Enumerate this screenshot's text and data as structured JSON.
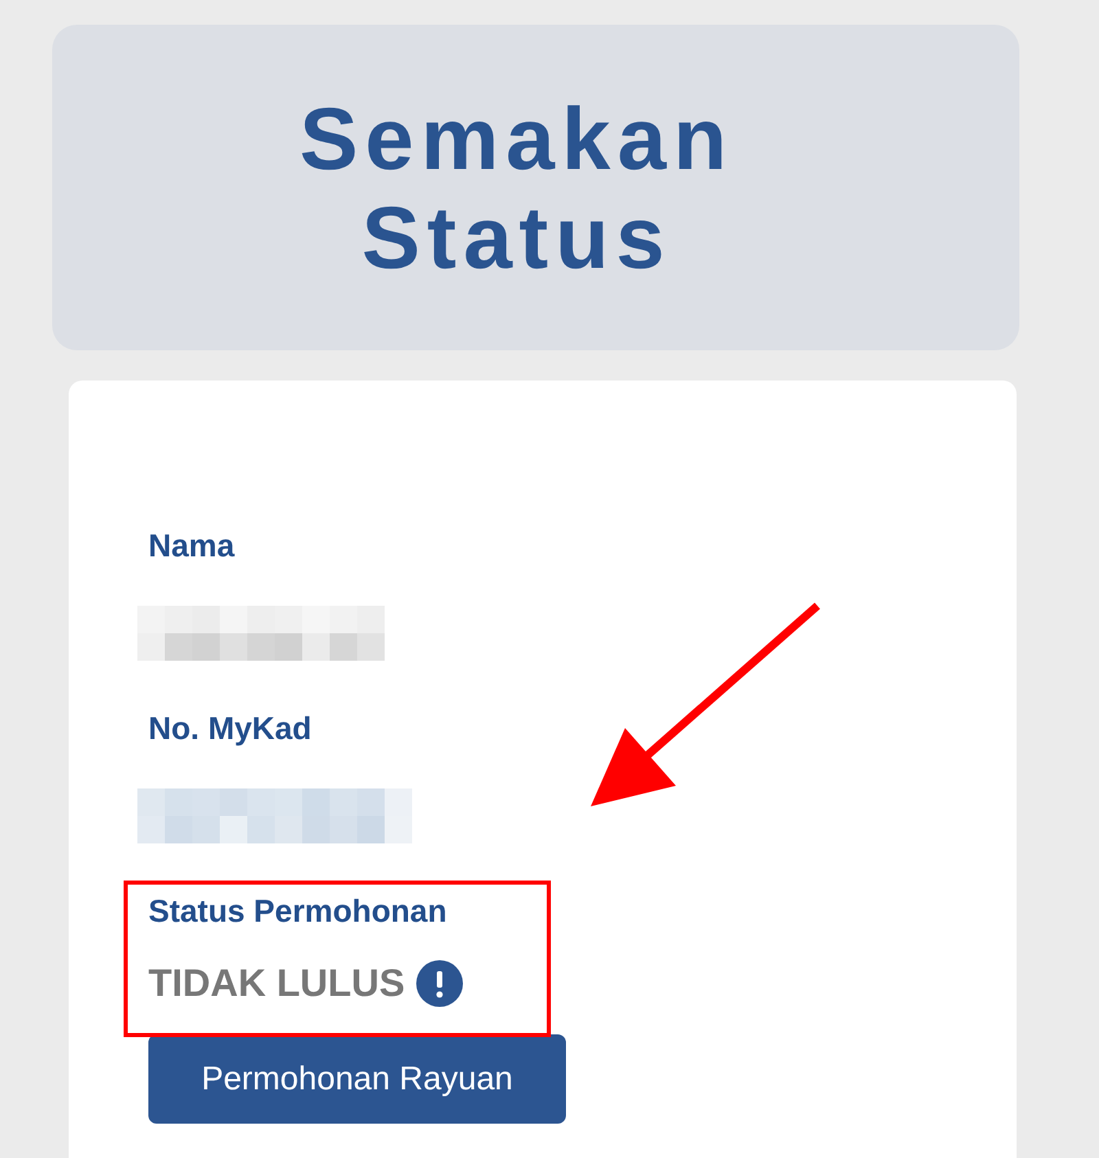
{
  "header": {
    "title": "Semakan Status"
  },
  "fields": [
    {
      "label": "Nama",
      "kind": "redacted"
    },
    {
      "label": "No. MyKad",
      "kind": "redacted"
    }
  ],
  "status": {
    "label": "Status Permohonan",
    "value": "TIDAK LULUS"
  },
  "button": {
    "label": "Permohonan Rayuan"
  }
}
